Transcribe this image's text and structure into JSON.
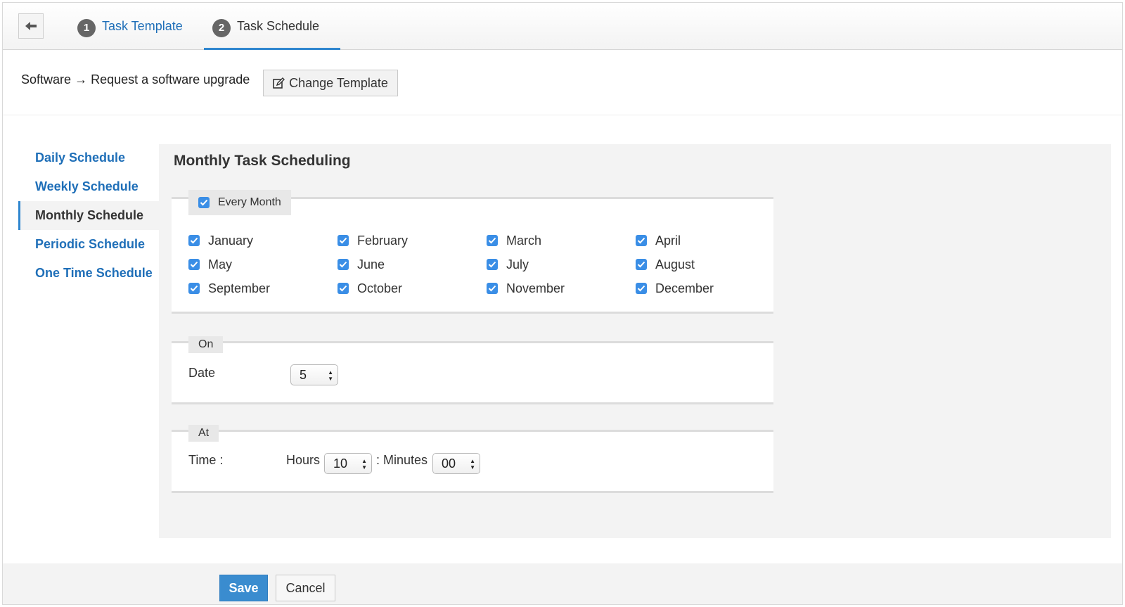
{
  "wizard": {
    "steps": [
      {
        "number": "1",
        "label": "Task Template"
      },
      {
        "number": "2",
        "label": "Task Schedule"
      }
    ]
  },
  "breadcrumb": {
    "category": "Software",
    "arrow": "→",
    "template": "Request a software upgrade"
  },
  "change_template_label": "Change Template",
  "sidenav": {
    "items": [
      {
        "label": "Daily Schedule"
      },
      {
        "label": "Weekly Schedule"
      },
      {
        "label": "Monthly Schedule",
        "active": true
      },
      {
        "label": "Periodic Schedule"
      },
      {
        "label": "One Time Schedule"
      }
    ]
  },
  "main": {
    "title": "Monthly Task Scheduling",
    "every_month": {
      "label": "Every Month",
      "checked": true
    },
    "months": [
      {
        "label": "January",
        "checked": true
      },
      {
        "label": "February",
        "checked": true
      },
      {
        "label": "March",
        "checked": true
      },
      {
        "label": "April",
        "checked": true
      },
      {
        "label": "May",
        "checked": true
      },
      {
        "label": "June",
        "checked": true
      },
      {
        "label": "July",
        "checked": true
      },
      {
        "label": "August",
        "checked": true
      },
      {
        "label": "September",
        "checked": true
      },
      {
        "label": "October",
        "checked": true
      },
      {
        "label": "November",
        "checked": true
      },
      {
        "label": "December",
        "checked": true
      }
    ],
    "on": {
      "legend": "On",
      "date_label": "Date",
      "date_value": "5"
    },
    "at": {
      "legend": "At",
      "time_label": "Time :",
      "hours_label": "Hours",
      "hours_value": "10",
      "minutes_label": ": Minutes",
      "minutes_value": "00"
    }
  },
  "footer": {
    "save_label": "Save",
    "cancel_label": "Cancel"
  },
  "colors": {
    "accent": "#2f86cf",
    "link": "#1f6fb8",
    "checkbox": "#3a8ee6",
    "save_button": "#3a8ccf"
  }
}
